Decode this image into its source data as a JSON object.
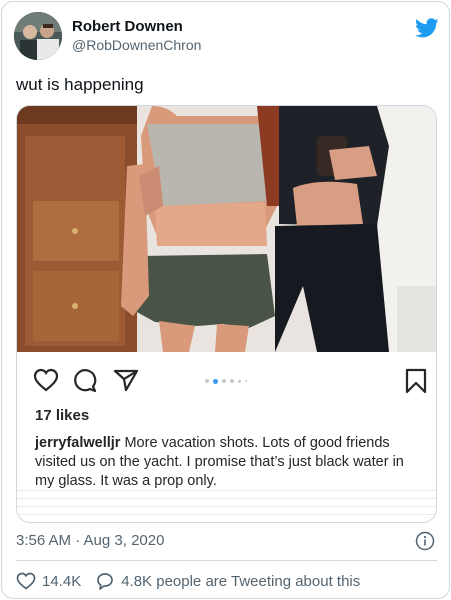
{
  "author": {
    "display_name": "Robert Downen",
    "handle": "@RobDownenChron"
  },
  "icons": {
    "brand": "twitter-bird-icon",
    "brand_color": "#1d9bf0"
  },
  "tweet": {
    "text": "wut is happening",
    "timestamp": "3:56 AM · Aug 3, 2020"
  },
  "embedded_post": {
    "likes": "17 likes",
    "username": "jerryfalwelljr",
    "caption": "More vacation shots.  Lots of good friends visited us on the yacht.  I promise that’s just black water in my glass.  It was a prop only.",
    "carousel_dots": 6,
    "active_dot": 2
  },
  "footer": {
    "likes_count": "14.4K",
    "replies_text": "4.8K people are Tweeting about this"
  }
}
